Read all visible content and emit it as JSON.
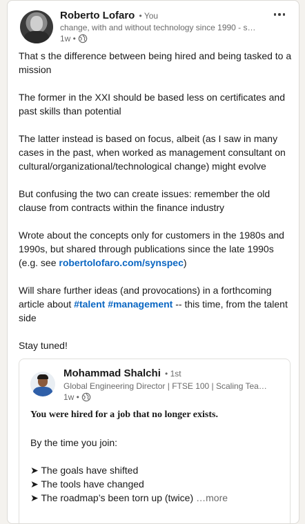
{
  "post": {
    "author": {
      "name": "Roberto Lofaro",
      "badge": "• You",
      "headline": "change, with and without technology since 1990 - s…",
      "time": "1w •"
    },
    "paragraphs": [
      "That s the difference between being hired and being tasked to a mission",
      "The former in the XXI should be based less on certificates and past skills than potential",
      "The latter instead is based on focus, albeit (as I saw in many cases in the past, when worked as management consultant on cultural/organizational/technological change) might evolve",
      "But confusing the two can create issues: remember the old clause from contracts within the finance industry"
    ],
    "p5_before": "Wrote about the concepts only for customers in the 1980s and 1990s, but shared through publications since the late 1990s (e.g. see ",
    "p5_link": "robertolofaro.com/synspec",
    "p5_after": ")",
    "p6_before": "Will share further ideas (and provocations) in a forthcoming article about ",
    "hashtag1": "#talent",
    "hashtag2": "#management",
    "p6_after": " -- this time, from the talent side",
    "closing": "Stay tuned!"
  },
  "reshare": {
    "author": {
      "name": "Mohammad Shalchi",
      "badge": "• 1st",
      "headline": "Global Engineering Director | FTSE 100 | Scaling Team…",
      "time": "1w •"
    },
    "bold_line": "You were hired for a job that no longer exists.",
    "line2": "By the time you join:",
    "bullets": [
      "➤ The goals have shifted",
      "➤ The tools have changed",
      "➤ The roadmap’s been torn up (twice)"
    ],
    "see_more": "…more"
  },
  "icons": {
    "visibility": "globe-icon",
    "menu": "more-horizontal-icon"
  },
  "colors": {
    "link": "#0a66c2",
    "background": "#f4f2ee",
    "card": "#ffffff"
  }
}
